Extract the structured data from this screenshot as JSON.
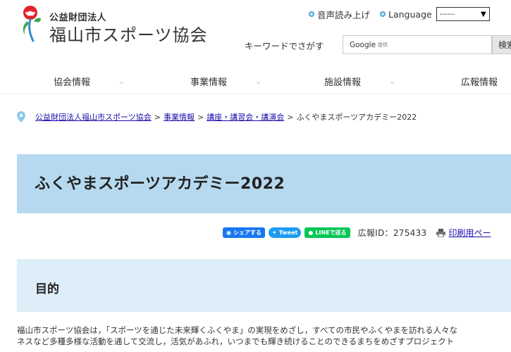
{
  "header": {
    "org_type": "公益財団法人",
    "org_name": "福山市スポーツ協会",
    "voice_reading": "音声読み上げ",
    "language": "Language",
    "language_selected": "------",
    "search_label": "キーワードでさがす",
    "search_engine": "Google",
    "search_provided": "提供",
    "search_button": "検索"
  },
  "nav": {
    "items": [
      {
        "label": "協会情報"
      },
      {
        "label": "事業情報"
      },
      {
        "label": "施設情報"
      },
      {
        "label": "広報情報"
      }
    ]
  },
  "breadcrumb": {
    "items": [
      "公益財団法人福山市スポーツ協会",
      "事業情報",
      "講座・講習会・講演会"
    ],
    "current": "ふくやまスポーツアカデミー2022",
    "separator": ">"
  },
  "page": {
    "title": "ふくやまスポーツアカデミー2022"
  },
  "share": {
    "facebook": "シェアする",
    "twitter": "Tweet",
    "line": "LINEで送る",
    "koho_id": "広報ID：275433",
    "print": "印刷用ペー"
  },
  "section": {
    "heading": "目的",
    "body_line1": "福山市スポーツ協会は，「スポーツを通じた未来輝くふくやま」の実現をめざし，すべての市民やふくやまを訪れる人々な",
    "body_line2": "ネスなど多種多様な活動を通して交流し，活気があふれ，いつまでも輝き続けることのできるまちをめざすプロジェクト"
  },
  "colors": {
    "title_banner": "#b6d9ef",
    "section_header": "#ddeef8",
    "logo_red": "#e0242b",
    "logo_green": "#3aa64a",
    "logo_blue": "#3b89c9",
    "link": "#1a0dab"
  }
}
